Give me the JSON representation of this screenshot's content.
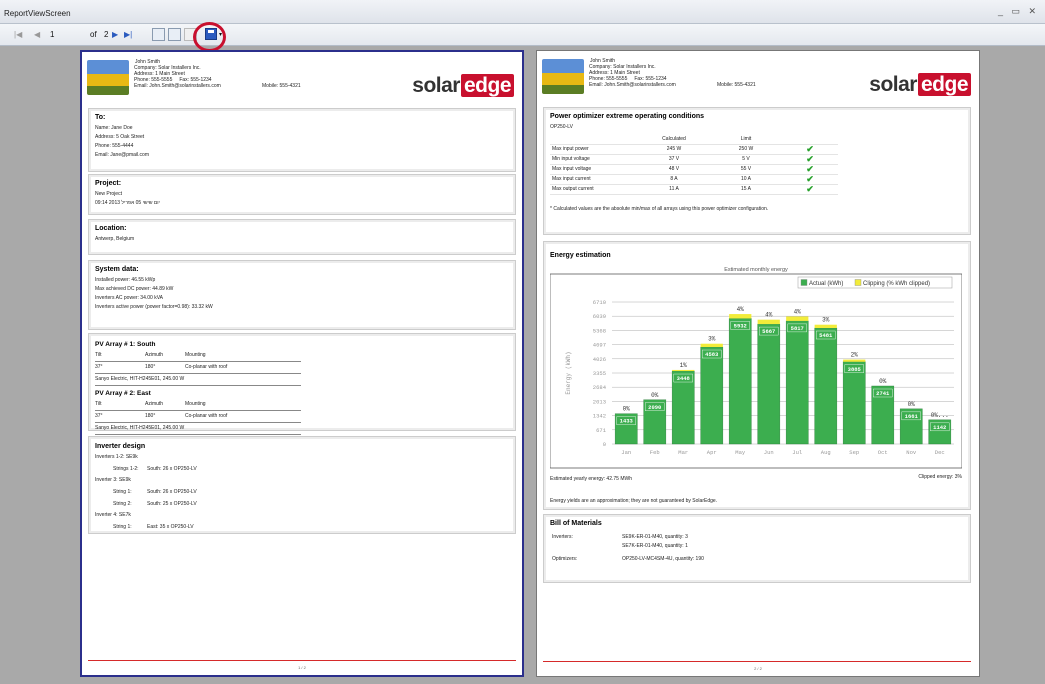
{
  "window": {
    "title": "ReportViewScreen",
    "controls": "_ ▭ ✕"
  },
  "toolbar": {
    "first": "|◀",
    "prev": "◀",
    "page": "1",
    "of_label": "of",
    "total": "2",
    "next": "▶",
    "last": "▶|"
  },
  "header": {
    "name": "John Smith",
    "company": "Company: Solar Installers Inc.",
    "address": "Address: 1 Main Street",
    "phone": "Phone: 555-5555",
    "fax": "Fax: 555-1234",
    "mobile": "Mobile: 555-4321",
    "email": "Email: John.Smith@solarinstallers.com",
    "logo_solar": "solar",
    "logo_edge": "edge"
  },
  "page1": {
    "to": {
      "title": "To:",
      "name": "Name: Jane Doe",
      "address": "Address: 5 Oak Street",
      "phone": "Phone: 555-4444",
      "email": "Email: Jane@pmail.com"
    },
    "project": {
      "title": "Project:",
      "name": "New Project",
      "date": "09:14 2013 יום שישי 05 אפריל"
    },
    "location": {
      "title": "Location:",
      "value": "Antwerp, Belgium"
    },
    "system": {
      "title": "System data:",
      "lines": [
        "Installed power: 46.55 kWp",
        "Max achieved DC power: 44.89 kW",
        "Inverters AC power: 34.00 kVA",
        "Inverters active power (power factor=0.98): 33.32 kW"
      ]
    },
    "arrays": [
      {
        "title": "PV Array # 1: South",
        "h1": "Tilt",
        "h2": "Azimuth",
        "h3": "Mounting",
        "tilt": "37°",
        "azimuth": "180°",
        "mounting": "Co-planar with roof",
        "module": "Sanyo Electric, HIT-H245E01, 245.00 W"
      },
      {
        "title": "PV Array # 2: East",
        "h1": "Tilt",
        "h2": "Azimuth",
        "h3": "Mounting",
        "tilt": "37°",
        "azimuth": "180°",
        "mounting": "Co-planar with roof",
        "module": "Sanyo Electric, HIT-H245E01, 245.00 W"
      }
    ],
    "inverter": {
      "title": "Inverter design",
      "g1": "Inverters 1-2: SE9k",
      "g1s1_label": "Strings 1-2:",
      "g1s1_value": "South: 26 x OP250-LV",
      "g2": "Inverter 3: SE9k",
      "g2s1_label": "String 1:",
      "g2s1_value": "South: 26 x OP250-LV",
      "g2s2_label": "String 2:",
      "g2s2_value": "South: 25 x OP250-LV",
      "g3": "Inverter 4: SE7k",
      "g3s1_label": "String 1:",
      "g3s1_value": "East: 35 x OP250-LV"
    },
    "footer": "1 / 2"
  },
  "page2": {
    "optimizer": {
      "title": "Power optimizer extreme operating conditions",
      "model": "OP250-LV",
      "col_calc": "Calculated",
      "col_limit": "Limit",
      "rows": [
        {
          "label": "Max input power",
          "calc": "245 W",
          "limit": "250 W"
        },
        {
          "label": "Min input voltage",
          "calc": "37 V",
          "limit": "5 V"
        },
        {
          "label": "Max input voltage",
          "calc": "48 V",
          "limit": "55 V"
        },
        {
          "label": "Max input current",
          "calc": "8 A",
          "limit": "10 A"
        },
        {
          "label": "Max output current",
          "calc": "11 A",
          "limit": "15 A"
        }
      ],
      "check": "✔",
      "note": "* Calculated values are the absolute min/max of all arrays using this power optimizer configuration."
    },
    "energy": {
      "title": "Energy estimation",
      "yearly": "Estimated yearly energy: 42.75 MWh",
      "clipped": "Clipped energy: 3%",
      "disclaimer": "Energy yields are an approximation; they are not guaranteed by SolarEdge."
    },
    "bom": {
      "title": "Bill of Materials",
      "inv_label": "Inverters:",
      "inv_1": "SE9K-ER-01-M40, quantity: 3",
      "inv_2": "SE7K-ER-01-M40, quantity: 1",
      "opt_label": "Optimizers:",
      "opt_1": "OP250-LV-MC4SM-4U, quantity: 190"
    },
    "footer": "2 / 2"
  },
  "chart_data": {
    "type": "bar",
    "title": "Estimated monthly energy",
    "ylabel": "Energy (kWh)",
    "categories": [
      "Jan",
      "Feb",
      "Mar",
      "Apr",
      "May",
      "Jun",
      "Jul",
      "Aug",
      "Sep",
      "Oct",
      "Nov",
      "Dec"
    ],
    "series": [
      {
        "name": "Actual (kWh)",
        "values": [
          1433,
          2090,
          3448,
          4583,
          5932,
          5667,
          5817,
          5481,
          3885,
          2741,
          1661,
          1142
        ],
        "color": "#3cae4f"
      },
      {
        "name": "Clipping (% kWh clipped)",
        "values": [
          "0%",
          "0%",
          "1%",
          "3%",
          "4%",
          "4%",
          "4%",
          "3%",
          "2%",
          "0%",
          "0%",
          "0%..."
        ],
        "color": "#f2ec3a"
      }
    ],
    "yticks": [
      "0",
      "671",
      "1342",
      "2013",
      "2684",
      "3355",
      "4026",
      "4697",
      "5368",
      "6039",
      "6710"
    ],
    "ylim": [
      0,
      6710
    ],
    "grid": true,
    "legend": "top-right"
  }
}
